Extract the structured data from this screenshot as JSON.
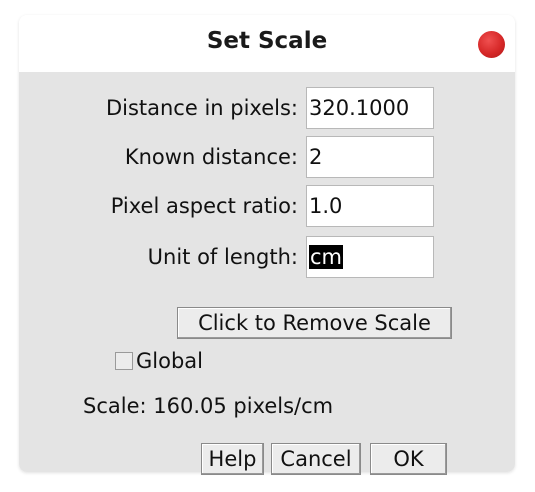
{
  "window": {
    "title": "Set Scale"
  },
  "fields": [
    {
      "label": "Distance in pixels:",
      "value": "320.1000"
    },
    {
      "label": "Known distance:",
      "value": "2"
    },
    {
      "label": "Pixel aspect ratio:",
      "value": "1.0"
    },
    {
      "label": "Unit of length:",
      "value": "cm"
    }
  ],
  "remove_scale_button": "Click to Remove Scale",
  "global_checkbox": {
    "label": "Global",
    "checked": false
  },
  "scale_status": "Scale: 160.05 pixels/cm",
  "buttons": {
    "help": "Help",
    "cancel": "Cancel",
    "ok": "OK"
  },
  "colors": {
    "close_button": "#d62828",
    "content_background": "#e4e4e4",
    "selection_background": "#000000"
  }
}
